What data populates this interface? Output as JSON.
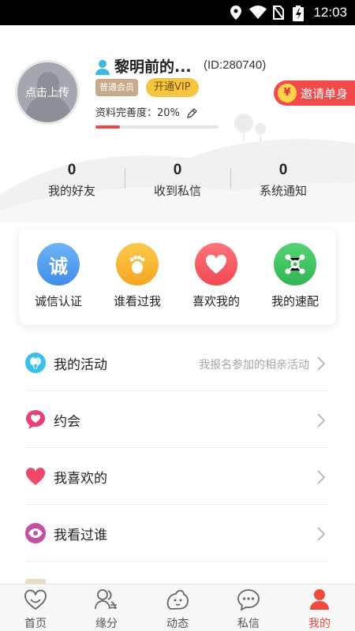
{
  "status_bar": {
    "time": "12:03"
  },
  "profile": {
    "avatar_hint": "点击上传",
    "nickname": "黎明前的...",
    "id_text": "(ID:280740)",
    "member_badge": "普通会员",
    "vip_button": "开通VIP",
    "completion_text": "资料完善度：20%",
    "completion_value": 0.2,
    "invite_label": "邀请单身",
    "invite_coin": "¥"
  },
  "stats": [
    {
      "value": "0",
      "label": "我的好友"
    },
    {
      "value": "0",
      "label": "收到私信"
    },
    {
      "value": "0",
      "label": "系统通知"
    }
  ],
  "quick_actions": [
    {
      "label": "诚信认证",
      "glyph": "诚",
      "icon": "integrity-icon",
      "color": "#4f9cf0"
    },
    {
      "label": "谁看过我",
      "icon": "footprint-icon",
      "color": "#f7b52e"
    },
    {
      "label": "喜欢我的",
      "icon": "heart-icon",
      "color": "#f25a5f"
    },
    {
      "label": "我的速配",
      "icon": "match-icon",
      "color": "#3fc25e"
    }
  ],
  "menu": [
    {
      "label": "我的活动",
      "hint": "我报名参加的相亲活动",
      "icon": "activity-balloon-icon",
      "color": "#3bbfe8"
    },
    {
      "label": "约会",
      "hint": "",
      "icon": "date-chat-heart-icon",
      "color": "#e8407c"
    },
    {
      "label": "我喜欢的",
      "hint": "",
      "icon": "heart-icon",
      "color": "#f0476b"
    },
    {
      "label": "我看过谁",
      "hint": "",
      "icon": "eye-icon",
      "color": "#c64fa6"
    }
  ],
  "tabs": [
    {
      "label": "首页",
      "icon": "home-heart-icon",
      "active": false
    },
    {
      "label": "缘分",
      "icon": "people-icon",
      "active": false
    },
    {
      "label": "动态",
      "icon": "moments-icon",
      "active": false
    },
    {
      "label": "私信",
      "icon": "message-icon",
      "active": false
    },
    {
      "label": "我的",
      "icon": "profile-icon",
      "active": true
    }
  ],
  "colors": {
    "accent": "#f0493e",
    "progress": "#e84a4a",
    "vip": "#f5c542",
    "member": "#c8aa8a"
  }
}
